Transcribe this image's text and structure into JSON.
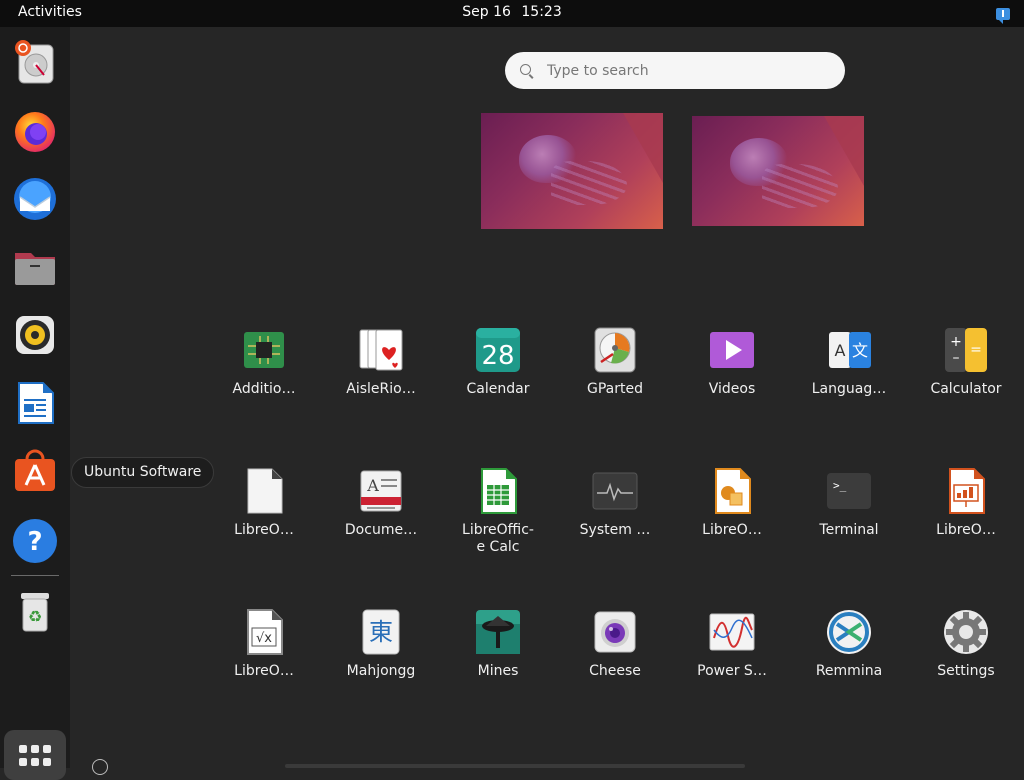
{
  "topbar": {
    "activities": "Activities",
    "date": "Sep 16",
    "time": "15:23",
    "tray_icon": "notification-icon"
  },
  "dock": {
    "items": [
      {
        "name": "ubuntu-installer",
        "icon": "install-disk-icon"
      },
      {
        "name": "firefox",
        "icon": "firefox-icon"
      },
      {
        "name": "thunderbird",
        "icon": "thunderbird-icon"
      },
      {
        "name": "files",
        "icon": "folder-icon"
      },
      {
        "name": "rhythmbox",
        "icon": "speaker-icon"
      },
      {
        "name": "libreoffice-writer",
        "icon": "writer-icon"
      },
      {
        "name": "ubuntu-software",
        "icon": "software-bag-icon"
      },
      {
        "name": "help",
        "icon": "help-icon"
      },
      {
        "name": "trash",
        "icon": "trash-icon"
      }
    ],
    "tooltip": "Ubuntu Software",
    "show_apps_icon": "grid-icon"
  },
  "search": {
    "placeholder": "Type to search"
  },
  "apps": [
    {
      "label": "Additio…",
      "icon": "chip-icon"
    },
    {
      "label": "AisleRio…",
      "icon": "cards-icon"
    },
    {
      "label": "Calendar",
      "icon": "calendar-icon",
      "day": "28"
    },
    {
      "label": "GParted",
      "icon": "gparted-icon"
    },
    {
      "label": "Videos",
      "icon": "play-icon"
    },
    {
      "label": "Languag…",
      "icon": "language-icon"
    },
    {
      "label": "Calculator",
      "icon": "calculator-icon"
    },
    {
      "label": "LibreO…",
      "icon": "blank-doc-icon"
    },
    {
      "label": "Docume…",
      "icon": "document-viewer-icon"
    },
    {
      "label": "LibreOffic-\ne Calc",
      "icon": "calc-icon"
    },
    {
      "label": "System …",
      "icon": "system-monitor-icon"
    },
    {
      "label": "LibreO…",
      "icon": "draw-icon"
    },
    {
      "label": "Terminal",
      "icon": "terminal-icon"
    },
    {
      "label": "LibreO…",
      "icon": "impress-icon"
    },
    {
      "label": "LibreO…",
      "icon": "math-icon"
    },
    {
      "label": "Mahjongg",
      "icon": "mahjongg-icon"
    },
    {
      "label": "Mines",
      "icon": "mines-icon"
    },
    {
      "label": "Cheese",
      "icon": "camera-icon"
    },
    {
      "label": "Power S…",
      "icon": "power-stats-icon"
    },
    {
      "label": "Remmina",
      "icon": "remmina-icon"
    },
    {
      "label": "Settings",
      "icon": "gear-icon"
    }
  ],
  "glyphs": {
    "calendar_day": "28",
    "terminal_prompt": ">_",
    "mahjongg_char": "東",
    "lang_a": "A",
    "lang_zh": "文",
    "help_mark": "?",
    "math_mark": "√x",
    "calc_plus": "+",
    "calc_eq": "=",
    "calc_minus": "–",
    "trash_mark": "♻",
    "doc_mark": "A"
  }
}
